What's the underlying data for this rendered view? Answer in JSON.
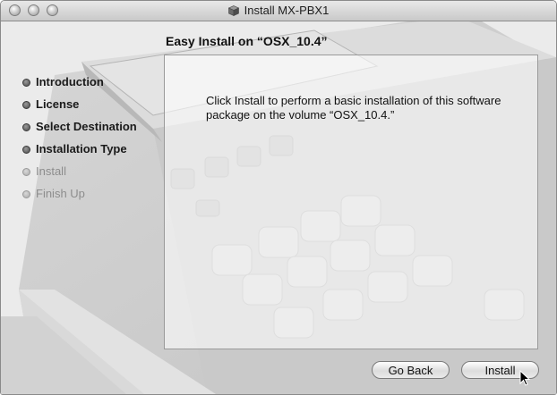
{
  "window": {
    "title": "Install MX-PBX1",
    "controls": [
      "close-button",
      "minimize-button",
      "zoom-button"
    ]
  },
  "main": {
    "step_title": "Easy Install on “OSX_10.4”",
    "message": "Click Install to perform a basic installation of this software package on the volume “OSX_10.4.”"
  },
  "sidebar": {
    "steps": [
      {
        "label": "Introduction",
        "state": "completed"
      },
      {
        "label": "License",
        "state": "completed"
      },
      {
        "label": "Select Destination",
        "state": "completed"
      },
      {
        "label": "Installation Type",
        "state": "current"
      },
      {
        "label": "Install",
        "state": "pending"
      },
      {
        "label": "Finish Up",
        "state": "pending"
      }
    ]
  },
  "buttons": {
    "back_label": "Go Back",
    "install_label": "Install"
  },
  "colors": {
    "window_background": "#e9e9e9",
    "titlebar_top": "#e8e8e8",
    "titlebar_bottom": "#c9c9c9",
    "step_done_text": "#1a1a1a",
    "step_pending_text": "#8d8d8d"
  },
  "icons": {
    "title_icon": "package-icon",
    "cursor": "arrow-pointer-icon"
  }
}
